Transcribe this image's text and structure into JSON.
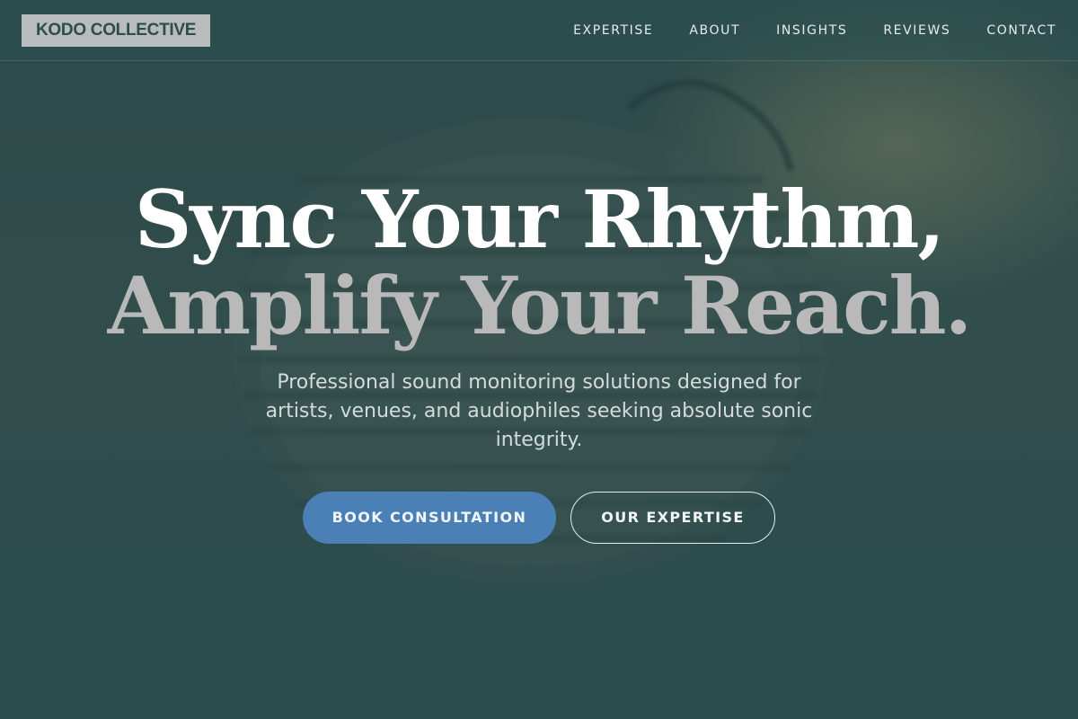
{
  "header": {
    "logo": "KODO COLLECTIVE",
    "nav": [
      {
        "label": "EXPERTISE"
      },
      {
        "label": "ABOUT"
      },
      {
        "label": "INSIGHTS"
      },
      {
        "label": "REVIEWS"
      },
      {
        "label": "CONTACT"
      }
    ]
  },
  "hero": {
    "headline_line1": "Sync Your Rhythm,",
    "headline_line2": "Amplify Your Reach.",
    "subtitle": "Professional sound monitoring solutions designed for artists, venues, and audiophiles seeking absolute sonic integrity.",
    "primary_cta": "BOOK CONSULTATION",
    "secondary_cta": "OUR EXPERTISE",
    "background_image": "headphones-icon"
  },
  "colors": {
    "background": "#2e4c4b",
    "primary_button": "#4a80b6",
    "logo_background": "#b9bcbc",
    "headline_primary": "#ffffff",
    "headline_secondary": "#b9b9b9"
  }
}
